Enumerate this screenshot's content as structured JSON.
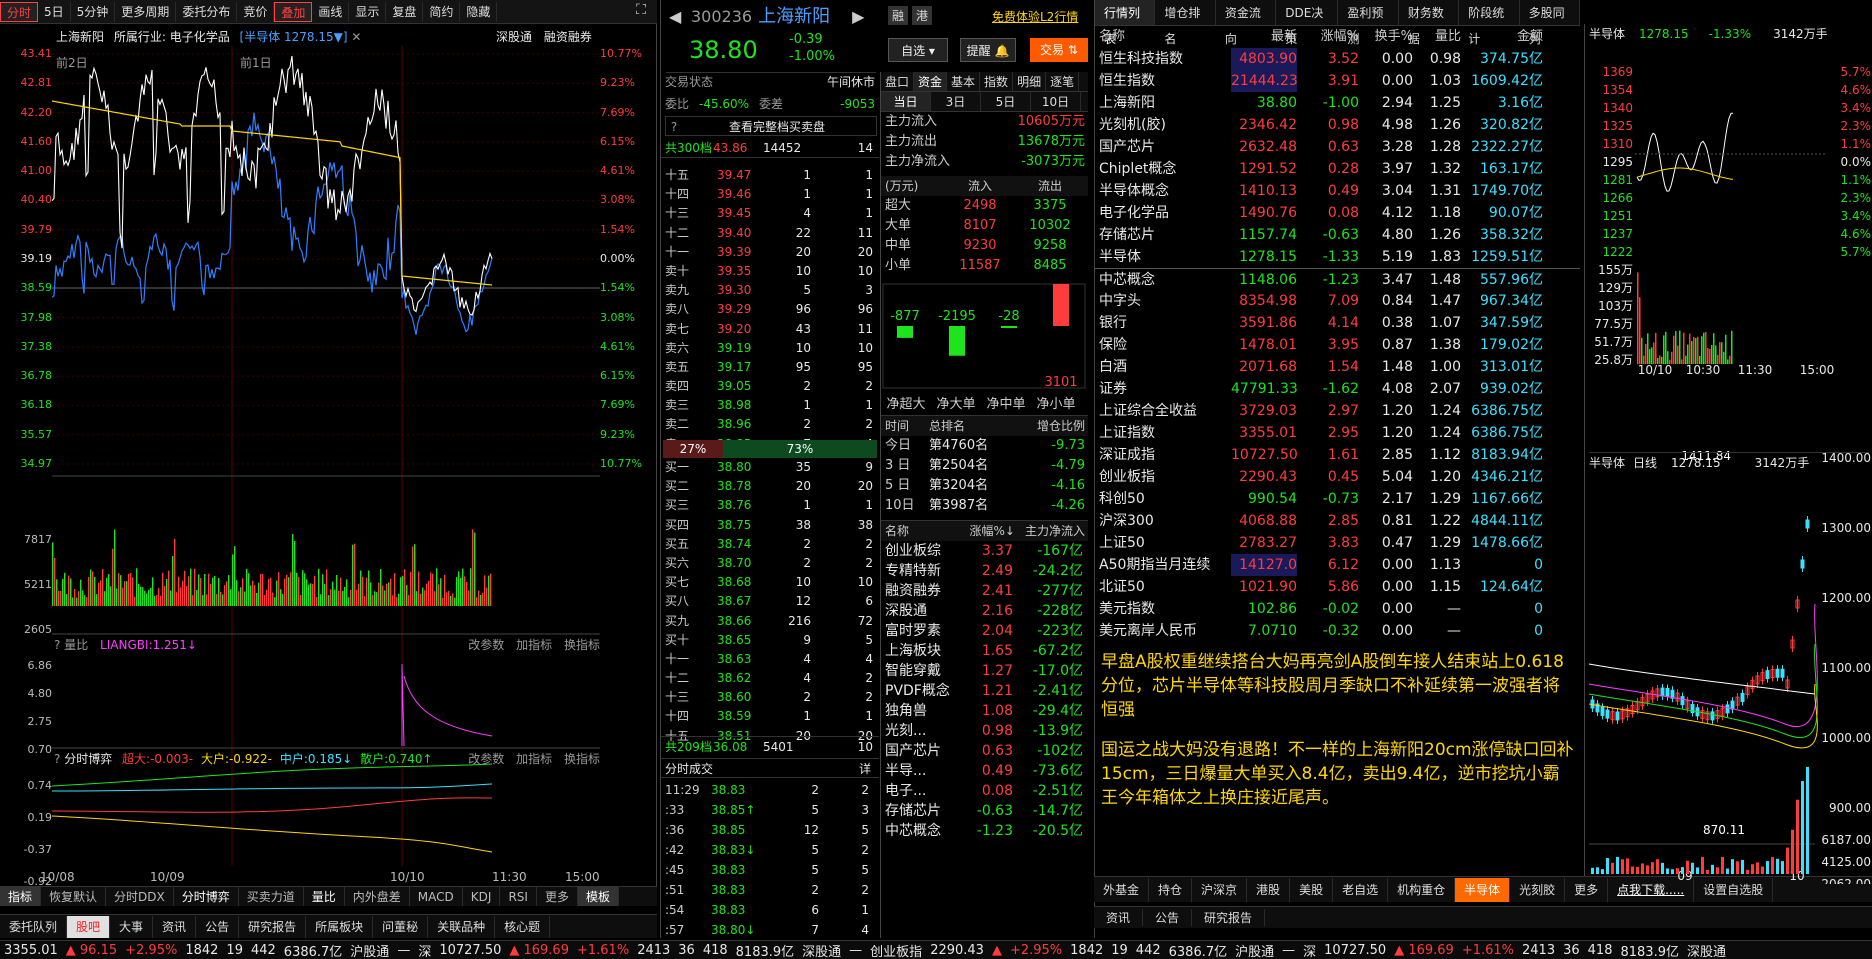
{
  "toolbar": {
    "items": [
      "分时",
      "5日",
      "5分钟",
      "更多周期",
      "委托分布",
      "竞价",
      "叠加",
      "画线",
      "显示",
      "复盘",
      "简约",
      "隐藏"
    ]
  },
  "chart": {
    "stock_name": "上海新阳",
    "industry": "所属行业: 电子化学品",
    "overlay": "[半导体 1278.15▼]",
    "links": [
      "深股通",
      "融资融券"
    ],
    "ylabels_left": [
      "43.41",
      "42.81",
      "42.20",
      "41.60",
      "41.00",
      "40.40",
      "39.79",
      "39.19",
      "38.59",
      "37.98",
      "37.38",
      "36.78",
      "36.18",
      "35.57",
      "34.97"
    ],
    "ylabels_right": [
      "10.77%",
      "9.23%",
      "7.69%",
      "6.15%",
      "4.61%",
      "3.08%",
      "1.54%",
      "0.00%",
      "1.54%",
      "3.08%",
      "4.61%",
      "6.15%",
      "7.69%",
      "9.23%",
      "10.77%"
    ],
    "day_labels": [
      "前2日",
      "前1日"
    ],
    "vol_labels": [
      "7817",
      "5211",
      "2605"
    ],
    "liangbi": {
      "title": "量比",
      "value": "LIANGBI:1.251↓",
      "links": [
        "改参数",
        "加指标",
        "换指标"
      ],
      "y": [
        "6.86",
        "4.80",
        "2.75",
        "0.70"
      ]
    },
    "boyi": {
      "title": "分时博弈",
      "items": [
        "超大:-0.003-",
        "大户:-0.922-",
        "中户:0.185↓",
        "散户:0.740↑"
      ],
      "links": [
        "改参数",
        "加指标",
        "换指标"
      ],
      "y": [
        "0.74",
        "0.19",
        "-0.37",
        "-0.92"
      ]
    },
    "xlabels": [
      "10/08",
      "10/09",
      "10/10",
      "11:30",
      "15:00"
    ],
    "bottom_tabs": [
      "指标",
      "恢复默认",
      "分时DDX",
      "分时博弈",
      "买卖力道",
      "量比",
      "内外盘差",
      "MACD",
      "KDJ",
      "RSI",
      "更多",
      "模板"
    ],
    "bottom_tabs2": [
      "委托队列",
      "股吧",
      "大事",
      "资讯",
      "公告",
      "研究报告",
      "所属板块",
      "问董秘",
      "关联品种",
      "核心题"
    ]
  },
  "quote": {
    "code": "300236",
    "name": "上海新阳",
    "badges": [
      "融",
      "港"
    ],
    "trial": "免费体验L2行情",
    "price": "38.80",
    "change": "-0.39",
    "pct": "-1.00%",
    "buttons": [
      "自选",
      "提醒",
      "交易"
    ],
    "status_label": "交易状态",
    "status": "午间休市",
    "webi_label": "委比",
    "webi": "-45.60%",
    "wecha_label": "委差",
    "wecha": "-9053",
    "full_book": "查看完整档买卖盘",
    "sell_total": [
      "共300档",
      "43.86",
      "14452",
      "14"
    ],
    "sells": [
      [
        "十五",
        "39.47",
        "1",
        "1"
      ],
      [
        "十四",
        "39.46",
        "1",
        "1"
      ],
      [
        "十三",
        "39.45",
        "4",
        "1"
      ],
      [
        "十二",
        "39.40",
        "22",
        "11"
      ],
      [
        "十一",
        "39.39",
        "20",
        "20"
      ],
      [
        "卖十",
        "39.35",
        "10",
        "10"
      ],
      [
        "卖九",
        "39.30",
        "5",
        "3"
      ],
      [
        "卖八",
        "39.29",
        "96",
        "96"
      ],
      [
        "卖七",
        "39.20",
        "43",
        "11"
      ],
      [
        "卖六",
        "39.19",
        "10",
        "10"
      ],
      [
        "卖五",
        "39.17",
        "95",
        "95"
      ],
      [
        "卖四",
        "39.05",
        "2",
        "2"
      ],
      [
        "卖三",
        "38.98",
        "1",
        "1"
      ],
      [
        "卖二",
        "38.96",
        "2",
        "2"
      ],
      [
        "卖一",
        "38.85",
        "7",
        "4"
      ]
    ],
    "ratio": [
      "27%",
      "73%"
    ],
    "buys": [
      [
        "买一",
        "38.80",
        "35",
        "9"
      ],
      [
        "买二",
        "38.78",
        "20",
        "20"
      ],
      [
        "买三",
        "38.76",
        "1",
        "1"
      ],
      [
        "买四",
        "38.75",
        "38",
        "38"
      ],
      [
        "买五",
        "38.74",
        "2",
        "2"
      ],
      [
        "买六",
        "38.70",
        "2",
        "2"
      ],
      [
        "买七",
        "38.68",
        "10",
        "10"
      ],
      [
        "买八",
        "38.67",
        "12",
        "6"
      ],
      [
        "买九",
        "38.66",
        "216",
        "72"
      ],
      [
        "买十",
        "38.65",
        "9",
        "5"
      ],
      [
        "十一",
        "38.63",
        "4",
        "4"
      ],
      [
        "十二",
        "38.62",
        "4",
        "2"
      ],
      [
        "十三",
        "38.60",
        "2",
        "2"
      ],
      [
        "十四",
        "38.59",
        "1",
        "1"
      ],
      [
        "十五",
        "38.51",
        "20",
        "20"
      ]
    ],
    "buy_total": [
      "共209档",
      "36.08",
      "5401",
      "10"
    ],
    "trades_title": "分时成交",
    "trades_more": "详",
    "trades": [
      [
        "11:29",
        "38.83",
        "2",
        "2"
      ],
      [
        ":33",
        "38.85↑",
        "5",
        "3"
      ],
      [
        ":36",
        "38.85",
        "12",
        "5"
      ],
      [
        ":42",
        "38.83↓",
        "5",
        "2"
      ],
      [
        ":45",
        "38.83",
        "5",
        "5"
      ],
      [
        ":51",
        "38.83",
        "2",
        "2"
      ],
      [
        ":54",
        "38.83",
        "6",
        "1"
      ],
      [
        ":57",
        "38.80↓",
        "7",
        "4"
      ]
    ]
  },
  "fund": {
    "tabs": [
      "盘口",
      "资金",
      "基本",
      "指数",
      "明细",
      "逐笔"
    ],
    "periods": [
      "当日",
      "3日",
      "5日",
      "10日"
    ],
    "flows": [
      [
        "主力流入",
        "10605万元"
      ],
      [
        "主力流出",
        "13678万元"
      ],
      [
        "主力净流入",
        "-3073万元"
      ]
    ],
    "table_head": [
      "(万元)",
      "流入",
      "流出"
    ],
    "table": [
      [
        "超大",
        "2498",
        "3375"
      ],
      [
        "大单",
        "8107",
        "10302"
      ],
      [
        "中单",
        "9230",
        "9258"
      ],
      [
        "小单",
        "11587",
        "8485"
      ]
    ],
    "bars": [
      {
        "label": "-877",
        "value": -877
      },
      {
        "label": "-2195",
        "value": -2195
      },
      {
        "label": "-28",
        "value": -28
      },
      {
        "label": "3101",
        "value": 3101
      }
    ],
    "bar_names": [
      "净超大",
      "净大单",
      "净中单",
      "净小单"
    ],
    "rank_head": [
      "时间",
      "总排名",
      "增仓比例"
    ],
    "ranks": [
      [
        "今日",
        "第4760名",
        "-9.73"
      ],
      [
        "3 日",
        "第2504名",
        "-4.79"
      ],
      [
        "5 日",
        "第3204名",
        "-4.16"
      ],
      [
        "10日",
        "第3987名",
        "-4.26"
      ]
    ],
    "sector_head": [
      "名称",
      "涨幅%↓",
      "主力净流入"
    ],
    "sectors": [
      [
        "创业板综",
        "3.37",
        "-167亿"
      ],
      [
        "专精特新",
        "2.49",
        "-24.2亿"
      ],
      [
        "融资融券",
        "2.41",
        "-277亿"
      ],
      [
        "深股通",
        "2.16",
        "-228亿"
      ],
      [
        "富时罗素",
        "2.04",
        "-223亿"
      ],
      [
        "上海板块",
        "1.65",
        "-67.2亿"
      ],
      [
        "智能穿戴",
        "1.27",
        "-17.0亿"
      ],
      [
        "PVDF概念",
        "1.21",
        "-2.41亿"
      ],
      [
        "独角兽",
        "1.08",
        "-29.4亿"
      ],
      [
        "光刻...",
        "0.98",
        "-13.9亿"
      ],
      [
        "国产芯片",
        "0.63",
        "-102亿"
      ],
      [
        "半导...",
        "0.49",
        "-73.6亿"
      ],
      [
        "电子...",
        "0.08",
        "-2.51亿"
      ],
      [
        "存储芯片",
        "-0.63",
        "-14.7亿"
      ],
      [
        "中芯概念",
        "-1.23",
        "-20.5亿"
      ]
    ]
  },
  "market": {
    "tabs": [
      "行情列表",
      "增仓排名",
      "资金流向",
      "DDE决策",
      "盈利预测",
      "财务数据",
      "阶段统计",
      "多股同列"
    ],
    "head": [
      "名称",
      "最新",
      "涨幅%",
      "换手%",
      "量比",
      "金额"
    ],
    "rows": [
      [
        "恒生科技指数",
        "4803.90",
        "3.52",
        "0.00",
        "0.98",
        "374.75亿"
      ],
      [
        "恒生指数",
        "21444.23",
        "3.91",
        "0.00",
        "1.03",
        "1609.42亿"
      ],
      [
        "上海新阳",
        "38.80",
        "-1.00",
        "2.94",
        "1.25",
        "3.16亿"
      ],
      [
        "光刻机(胶)",
        "2346.42",
        "0.98",
        "4.98",
        "1.26",
        "320.82亿"
      ],
      [
        "国产芯片",
        "2632.48",
        "0.63",
        "3.28",
        "1.28",
        "2322.27亿"
      ],
      [
        "Chiplet概念",
        "1291.52",
        "0.28",
        "3.97",
        "1.32",
        "163.17亿"
      ],
      [
        "半导体概念",
        "1410.13",
        "0.49",
        "3.04",
        "1.31",
        "1749.70亿"
      ],
      [
        "电子化学品",
        "1490.76",
        "0.08",
        "4.12",
        "1.18",
        "90.07亿"
      ],
      [
        "存储芯片",
        "1157.74",
        "-0.63",
        "4.80",
        "1.26",
        "358.32亿"
      ],
      [
        "半导体",
        "1278.15",
        "-1.33",
        "5.19",
        "1.83",
        "1259.51亿"
      ],
      [
        "中芯概念",
        "1148.06",
        "-1.23",
        "3.47",
        "1.48",
        "557.96亿"
      ],
      [
        "中字头",
        "8354.98",
        "7.09",
        "0.84",
        "1.47",
        "967.34亿"
      ],
      [
        "银行",
        "3591.86",
        "4.14",
        "0.38",
        "1.07",
        "347.59亿"
      ],
      [
        "保险",
        "1478.01",
        "3.95",
        "0.87",
        "1.38",
        "179.02亿"
      ],
      [
        "白酒",
        "2071.68",
        "1.54",
        "1.48",
        "1.00",
        "313.01亿"
      ],
      [
        "证券",
        "47791.33",
        "-1.62",
        "4.08",
        "2.07",
        "939.02亿"
      ],
      [
        "上证综合全收益",
        "3729.03",
        "2.97",
        "1.20",
        "1.24",
        "6386.75亿"
      ],
      [
        "上证指数",
        "3355.01",
        "2.95",
        "1.20",
        "1.24",
        "6386.75亿"
      ],
      [
        "深证成指",
        "10727.50",
        "1.61",
        "2.85",
        "1.12",
        "8183.94亿"
      ],
      [
        "创业板指",
        "2290.43",
        "0.45",
        "5.04",
        "1.20",
        "4346.21亿"
      ],
      [
        "科创50",
        "990.54",
        "-0.73",
        "2.17",
        "1.29",
        "1167.66亿"
      ],
      [
        "沪深300",
        "4068.88",
        "2.85",
        "0.81",
        "1.22",
        "4844.11亿"
      ],
      [
        "上证50",
        "2783.27",
        "3.83",
        "0.47",
        "1.29",
        "1478.66亿"
      ],
      [
        "A50期指当月连续",
        "14127.0",
        "6.12",
        "0.00",
        "1.13",
        "0"
      ],
      [
        "北证50",
        "1021.90",
        "5.86",
        "0.00",
        "1.15",
        "124.64亿"
      ],
      [
        "美元指数",
        "102.86",
        "-0.02",
        "0.00",
        "—",
        "0"
      ],
      [
        "美元离岸人民币",
        "7.0710",
        "-0.32",
        "0.00",
        "—",
        "0"
      ]
    ],
    "note1": "早盘A股权重继续搭台大妈再亮剑A股倒车接人结束站上0.618分位，芯片半导体等科技股周月季缺口不补延续第一波强者将恒强",
    "note2": "国运之战大妈没有退路！不一样的上海新阳20cm涨停缺口回补15cm，三日爆量大单买入8.4亿，卖出9.4亿，逆市挖坑小霸王今年箱体之上换庄接近尾声。",
    "bottom_tabs": [
      "外基金",
      "持仓",
      "沪深京",
      "港股",
      "美股",
      "老自选",
      "机构重仓",
      "半导体",
      "光刻胶",
      "更多",
      "点我下载.....",
      "设置自选股"
    ],
    "bottom_tabs2": [
      "资讯",
      "公告",
      "研究报告"
    ]
  },
  "mini": {
    "title": "半导体",
    "price": "1278.15",
    "pct": "-1.33%",
    "amount": "3142万手",
    "yl": [
      "1369",
      "1354",
      "1340",
      "1325",
      "1310",
      "1295",
      "1281",
      "1266",
      "1251",
      "1237",
      "1222"
    ],
    "yr": [
      "5.7%",
      "4.6%",
      "3.4%",
      "2.3%",
      "1.1%",
      "0.0%",
      "1.1%",
      "2.3%",
      "3.4%",
      "4.6%",
      "5.7%"
    ],
    "vol": [
      "155万",
      "129万",
      "103万",
      "77.5万",
      "51.7万",
      "25.8万"
    ],
    "xl": [
      "10/10",
      "10:30",
      "11:30",
      "15:00"
    ],
    "k_title": "半导体",
    "k_type": "日线",
    "k_price": "1278.15",
    "k_amount": "3142万手",
    "k_high": "1411.84",
    "k_low": "870.11",
    "k_y": [
      "1400.00",
      "1300.00",
      "1200.00",
      "1100.00",
      "1000.00",
      "900.00"
    ],
    "k_vol": [
      "6187.00",
      "4125.00",
      "2062.00"
    ],
    "k_x": [
      "09",
      "10"
    ]
  },
  "status": [
    "3355.01",
    "▲ 96.15",
    "+2.95%",
    "1842",
    "19",
    "442",
    "6386.7亿",
    "沪股通",
    "—",
    "深",
    "10727.50",
    "▲ 169.69",
    "+1.61%",
    "2413",
    "36",
    "418",
    "8183.9亿",
    "深股通",
    "—",
    "创业板指",
    "2290.43",
    "▲",
    "+2.95%",
    "1842",
    "19",
    "442",
    "6386.7亿",
    "沪股通",
    "—",
    "深",
    "10727.50",
    "▲ 169.69",
    "+1.61%",
    "2413",
    "36",
    "418",
    "8183.9亿",
    "深股通"
  ]
}
